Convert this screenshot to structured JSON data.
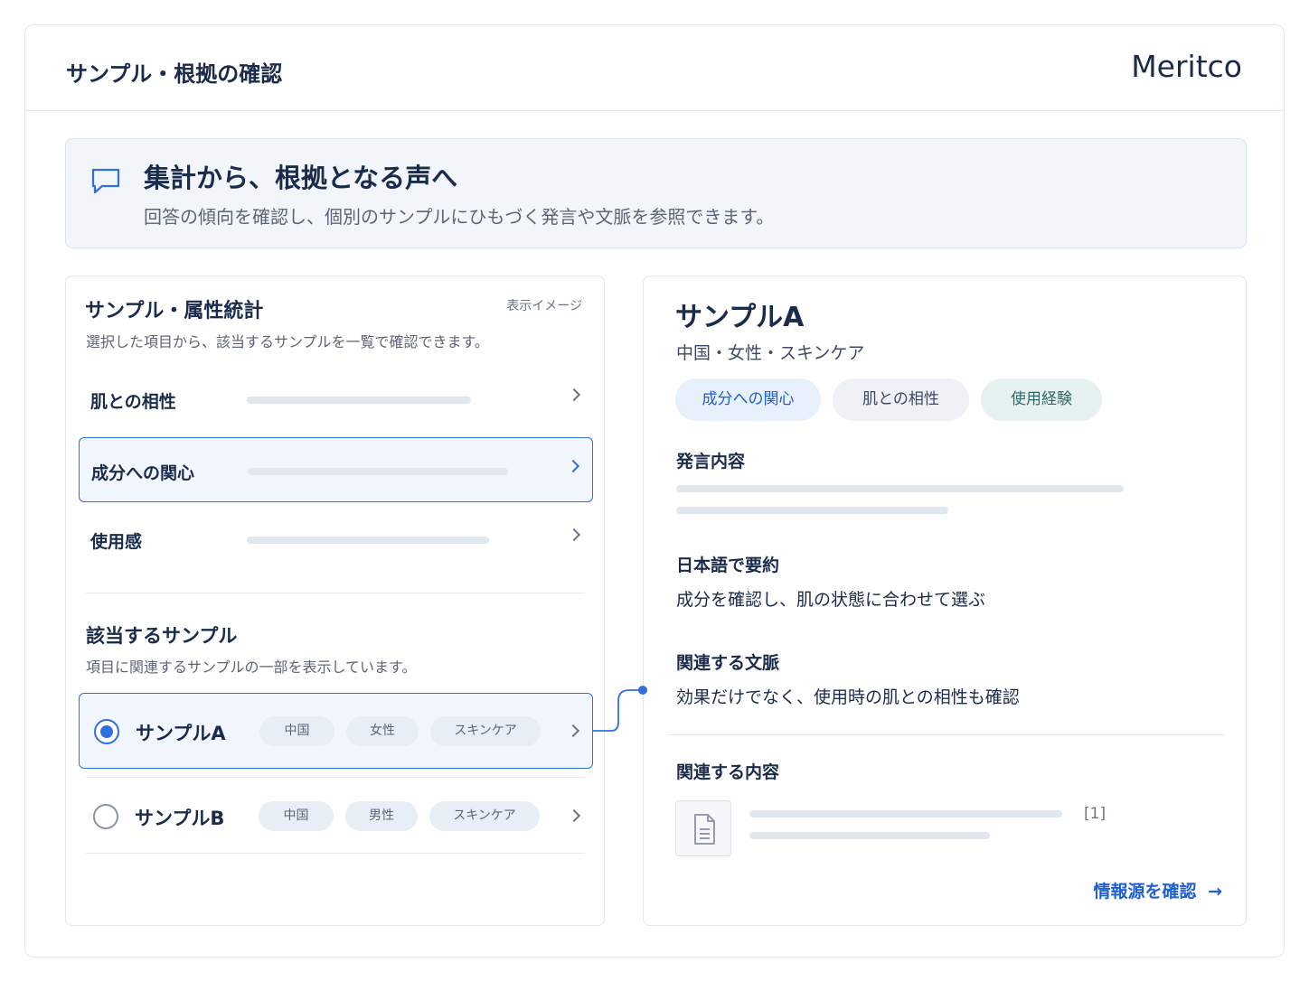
{
  "header": {
    "title": "サンプル・根拠の確認",
    "brand": "Meritco"
  },
  "banner": {
    "icon": "speech-bubble-icon",
    "heading": "集計から、根拠となる声へ",
    "description": "回答の傾向を確認し、個別のサンプルにひもづく発言や文脈を参照できます。"
  },
  "left_panel": {
    "title": "サンプル・属性統計",
    "badge": "表示イメージ",
    "subtitle": "選択した項目から、該当するサンプルを一覧で確認できます。",
    "items": [
      {
        "label": "肌との相性",
        "selected": false
      },
      {
        "label": "成分への関心",
        "selected": true
      },
      {
        "label": "使用感",
        "selected": false
      }
    ],
    "samples_heading": "該当するサンプル",
    "samples_subtitle": "項目に関連するサンプルの一部を表示しています。",
    "samples": [
      {
        "name": "サンプルA",
        "selected": true,
        "tags": [
          "中国",
          "女性",
          "スキンケア"
        ]
      },
      {
        "name": "サンプルB",
        "selected": false,
        "tags": [
          "中国",
          "男性",
          "スキンケア"
        ]
      }
    ]
  },
  "right_panel": {
    "title": "サンプルA",
    "attributes": "中国・女性・スキンケア",
    "tags": [
      {
        "label": "成分への関心",
        "color": "#1f5fd4",
        "bg": "#e8f0fc"
      },
      {
        "label": "肌との相性",
        "color": "#3d4a63",
        "bg": "#eef1f5"
      },
      {
        "label": "使用経験",
        "color": "#2d6a6a",
        "bg": "#e6f2f0"
      }
    ],
    "statement_heading": "発言内容",
    "summary_heading": "日本語で要約",
    "summary_text": "成分を確認し、肌の状態に合わせて選ぶ",
    "context_heading": "関連する文脈",
    "context_text": "効果だけでなく、使用時の肌との相性も確認",
    "related_heading": "関連する内容",
    "related_ref": "[1]",
    "source_link": "情報源を確認",
    "source_link_arrow": "→"
  }
}
